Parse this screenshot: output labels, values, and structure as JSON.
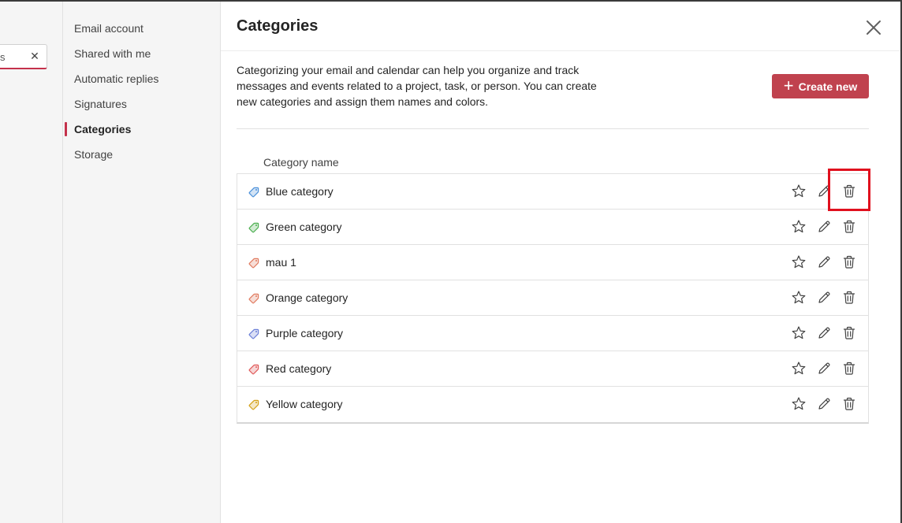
{
  "search": {
    "value": "s",
    "clear_icon": "close-icon"
  },
  "nav": {
    "items": [
      {
        "label": "Email account"
      },
      {
        "label": "Shared with me"
      },
      {
        "label": "Automatic replies"
      },
      {
        "label": "Signatures"
      },
      {
        "label": "Categories"
      },
      {
        "label": "Storage"
      }
    ],
    "active": "Categories",
    "accent_color": "#c4314b"
  },
  "main": {
    "title": "Categories",
    "description": "Categorizing your email and calendar can help you organize and track messages and events related to a project, task, or person. You can create new categories and assign them names and colors.",
    "create_button": "Create new",
    "column_header": "Category name",
    "button_color": "#c0424e"
  },
  "categories": [
    {
      "name": "Blue category",
      "color": "#4a90d9"
    },
    {
      "name": "Green category",
      "color": "#4caf50"
    },
    {
      "name": "mau 1",
      "color": "#e07a5f"
    },
    {
      "name": "Orange category",
      "color": "#e07a5f"
    },
    {
      "name": "Purple category",
      "color": "#6b7fd7"
    },
    {
      "name": "Red category",
      "color": "#e05a5a"
    },
    {
      "name": "Yellow category",
      "color": "#d4a017"
    }
  ],
  "icons": {
    "favorite": "star-icon",
    "edit": "pencil-icon",
    "delete": "trash-icon",
    "close": "close-icon",
    "tag": "tag-icon"
  }
}
